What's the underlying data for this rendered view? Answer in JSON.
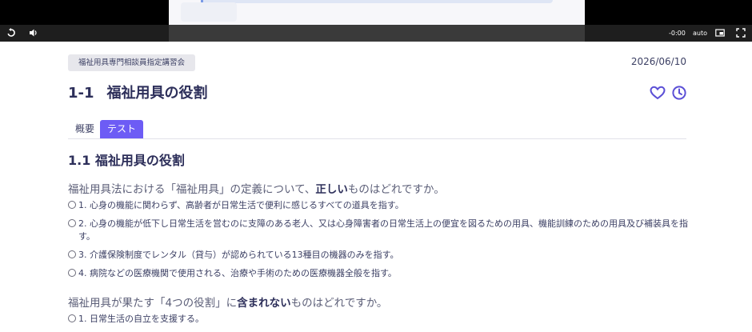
{
  "player": {
    "time": "-0:00",
    "quality": "auto",
    "icons": [
      "replay-icon",
      "volume-icon",
      "picture-in-picture-icon",
      "fullscreen-icon"
    ]
  },
  "course": {
    "tag": "福祉用具専門相談員指定講習会",
    "date": "2026/06/10",
    "title_num": "1-1",
    "title": "福祉用具の役割"
  },
  "tabs": [
    {
      "label": "概要",
      "active": false
    },
    {
      "label": "テスト",
      "active": true
    }
  ],
  "section": {
    "title": "1.1 福祉用具の役割"
  },
  "questions": [
    {
      "pre": "福祉用具法における「福祉用具」の定義について、",
      "emph": "正しい",
      "post": "ものはどれですか。",
      "options": [
        "1. 心身の機能に関わらず、高齢者が日常生活で便利に感じるすべての道具を指す。",
        "2. 心身の機能が低下し日常生活を営むのに支障のある老人、又は心身障害者の日常生活上の便宜を図るための用具、機能訓練のための用具及び補装具を指す。",
        "3. 介護保険制度でレンタル（貸与）が認められている13種目の機器のみを指す。",
        "4. 病院などの医療機関で使用される、治療や手術のための医療機器全般を指す。"
      ]
    },
    {
      "pre": "福祉用具が果たす「4つの役割」に",
      "emph": "含まれない",
      "post": "ものはどれですか。",
      "options": [
        "1. 日常生活の自立を支援する。"
      ]
    }
  ],
  "colors": {
    "accent": "#6d5cf5",
    "title": "#2d2f5a",
    "icon": "#5b4fd6"
  }
}
